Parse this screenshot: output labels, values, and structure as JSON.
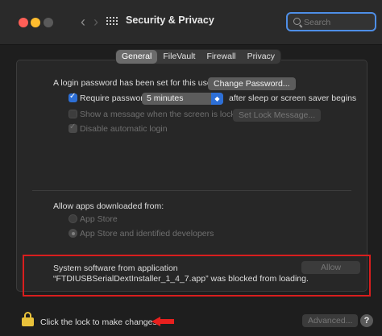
{
  "window": {
    "title": "Security & Privacy",
    "nav_back": "‹",
    "nav_forward": "›"
  },
  "search": {
    "placeholder": "Search"
  },
  "tabs": [
    {
      "label": "General",
      "active": true
    },
    {
      "label": "FileVault",
      "active": false
    },
    {
      "label": "Firewall",
      "active": false
    },
    {
      "label": "Privacy",
      "active": false
    }
  ],
  "general": {
    "login_password_text": "A login password has been set for this user",
    "change_password_button": "Change Password...",
    "require_password": {
      "label": "Require password",
      "checked": true,
      "interval_value": "5 minutes",
      "suffix": "after sleep or screen saver begins"
    },
    "show_message": {
      "label": "Show a message when the screen is locked",
      "checked": false,
      "button": "Set Lock Message..."
    },
    "disable_auto_login": {
      "label": "Disable automatic login",
      "checked": true
    }
  },
  "allow_apps": {
    "heading": "Allow apps downloaded from:",
    "options": [
      {
        "label": "App Store",
        "selected": false
      },
      {
        "label": "App Store and identified developers",
        "selected": true
      }
    ]
  },
  "blocked": {
    "line1": "System software from application",
    "line2": "“FTDIUSBSerialDextInstaller_1_4_7.app” was blocked from loading.",
    "allow_button": "Allow"
  },
  "footer": {
    "lock_text": "Click the lock to make changes.",
    "advanced_button": "Advanced...",
    "help_label": "?"
  },
  "colors": {
    "accent": "#2d6fd6",
    "highlight_border": "#d91e1e",
    "lock": "#e9c23b",
    "annotation_arrow": "#e8201e"
  }
}
